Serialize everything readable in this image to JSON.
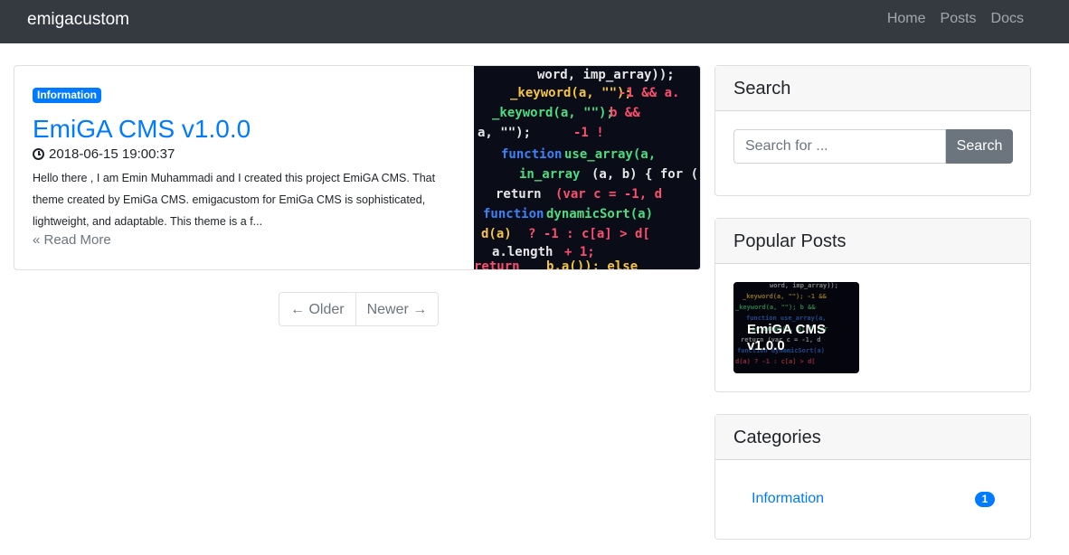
{
  "navbar": {
    "brand": "emigacustom",
    "links": [
      "Home",
      "Posts",
      "Docs"
    ]
  },
  "post": {
    "category": "Information",
    "title": "EmiGA CMS v1.0.0",
    "date": "2018-06-15 19:00:37",
    "excerpt": "Hello there , I am Emin Muhammadi and I created this project EmiGA CMS. That theme created by EmiGa CMS. emigacustom for EmiGa CMS is sophisticated, lightweight, and adaptable. This theme is a f...",
    "read_more": "« Read More"
  },
  "pagination": {
    "older": "← Older",
    "newer": "Newer →"
  },
  "sidebar": {
    "search": {
      "title": "Search",
      "placeholder": "Search for ...",
      "button": "Search"
    },
    "popular": {
      "title": "Popular Posts",
      "items": [
        {
          "title": "EmiGA CMS v1.0.0"
        }
      ]
    },
    "categories": {
      "title": "Categories",
      "items": [
        {
          "name": "Information",
          "count": "1"
        }
      ]
    }
  },
  "colors": {
    "navbar_bg": "#343a40",
    "primary": "#007bff",
    "secondary": "#6c757d"
  }
}
